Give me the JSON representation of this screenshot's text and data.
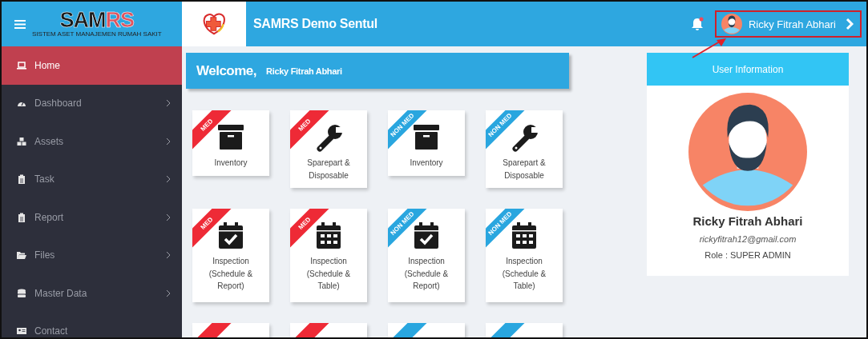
{
  "header": {
    "logo": {
      "text": "SAM",
      "accent_text": "RS",
      "subtitle": "SISTEM ASET MANAJEMEN RUMAH SAKIT"
    },
    "site_title": "SAMRS Demo Sentul",
    "notifications": {
      "unread": true
    },
    "user": {
      "name": "Ricky Fitrah Abhari",
      "highlighted": true
    }
  },
  "sidebar": {
    "items": [
      {
        "label": "Home",
        "selected": true,
        "has_children": false
      },
      {
        "label": "Dashboard",
        "selected": false,
        "has_children": true
      },
      {
        "label": "Assets",
        "selected": false,
        "has_children": true
      },
      {
        "label": "Task",
        "selected": false,
        "has_children": true
      },
      {
        "label": "Report",
        "selected": false,
        "has_children": true
      },
      {
        "label": "Files",
        "selected": false,
        "has_children": true
      },
      {
        "label": "Master Data",
        "selected": false,
        "has_children": true
      },
      {
        "label": "Contact",
        "selected": false,
        "has_children": false
      }
    ]
  },
  "welcome": {
    "greeting": "Welcome,",
    "name": "Ricky Fitrah Abhari"
  },
  "tiles": [
    {
      "kind": "med",
      "ribbon": "MED",
      "label": "Inventory"
    },
    {
      "kind": "med",
      "ribbon": "MED",
      "label": "Sparepart & Disposable"
    },
    {
      "kind": "nonmed",
      "ribbon": "NON MED",
      "label": "Inventory"
    },
    {
      "kind": "nonmed",
      "ribbon": "NON MED",
      "label": "Sparepart & Disposable"
    },
    {
      "kind": "med",
      "ribbon": "MED",
      "label": "Inspection (Schedule & Report)"
    },
    {
      "kind": "med",
      "ribbon": "MED",
      "label": "Inspection (Schedule & Table)"
    },
    {
      "kind": "nonmed",
      "ribbon": "NON MED",
      "label": "Inspection (Schedule & Report)"
    },
    {
      "kind": "nonmed",
      "ribbon": "NON MED",
      "label": "Inspection (Schedule & Table)"
    },
    {
      "kind": "med"
    },
    {
      "kind": "med"
    },
    {
      "kind": "nonmed"
    },
    {
      "kind": "nonmed"
    }
  ],
  "user_card": {
    "title": "User Information",
    "name": "Ricky Fitrah Abhari",
    "email": "rickyfitrah12@gmail.com",
    "role": "Role : SUPER ADMIN"
  }
}
